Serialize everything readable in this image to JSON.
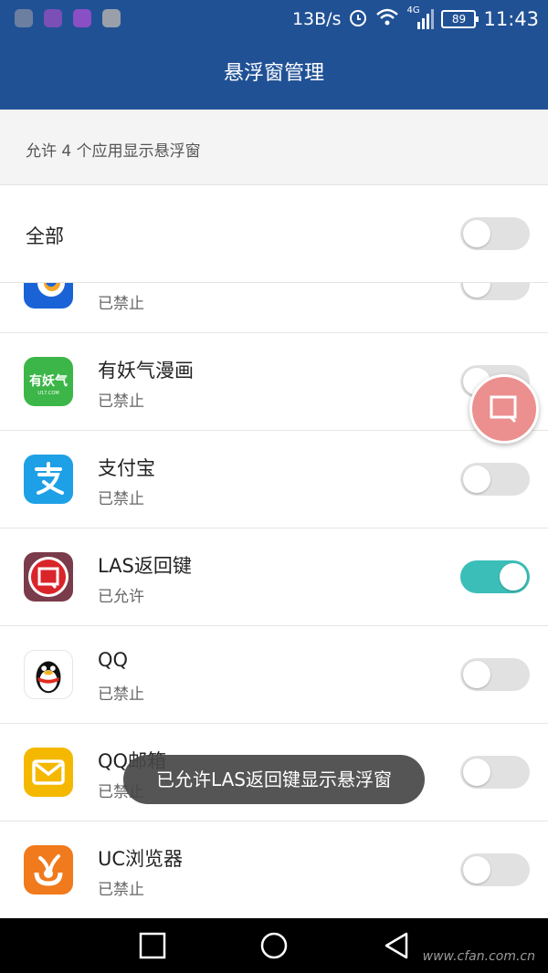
{
  "status_bar": {
    "net_speed": "13B/s",
    "network": "4G",
    "battery": "89",
    "time": "11:43",
    "left_icons": [
      "headset-app-icon",
      "photo-app-icon",
      "gallery-app-icon",
      "sync-app-icon"
    ],
    "right_icons": [
      "alarm-icon",
      "wifi-icon",
      "signal-icon",
      "battery-icon"
    ]
  },
  "title": "悬浮窗管理",
  "summary": "允许 4 个应用显示悬浮窗",
  "all_toggle": {
    "label": "全部",
    "on": false
  },
  "apps": [
    {
      "name": "",
      "status": "已禁止",
      "on": false,
      "icon": "blue-app-icon",
      "color": "#1a63d6"
    },
    {
      "name": "有妖气漫画",
      "status": "已禁止",
      "on": false,
      "icon": "youyaoqi-icon",
      "color": "#3cb648"
    },
    {
      "name": "支付宝",
      "status": "已禁止",
      "on": false,
      "icon": "alipay-icon",
      "color": "#1ea0e6"
    },
    {
      "name": "LAS返回键",
      "status": "已允许",
      "on": true,
      "icon": "las-back-icon",
      "color": "#7a3b4a"
    },
    {
      "name": "QQ",
      "status": "已禁止",
      "on": false,
      "icon": "qq-icon",
      "color": "#ffffff"
    },
    {
      "name": "QQ邮箱",
      "status": "已禁止",
      "on": false,
      "icon": "qq-mail-icon",
      "color": "#f5b800"
    },
    {
      "name": "UC浏览器",
      "status": "已禁止",
      "on": false,
      "icon": "uc-browser-icon",
      "color": "#f07a1c"
    }
  ],
  "toast": "已允许LAS返回键显示悬浮窗",
  "watermark": "www.cfan.com.cn",
  "colors": {
    "header": "#205195",
    "toggle_on": "#3bbeb8",
    "toggle_off": "#e1e1e1",
    "float_button": "#ec8f8f"
  }
}
